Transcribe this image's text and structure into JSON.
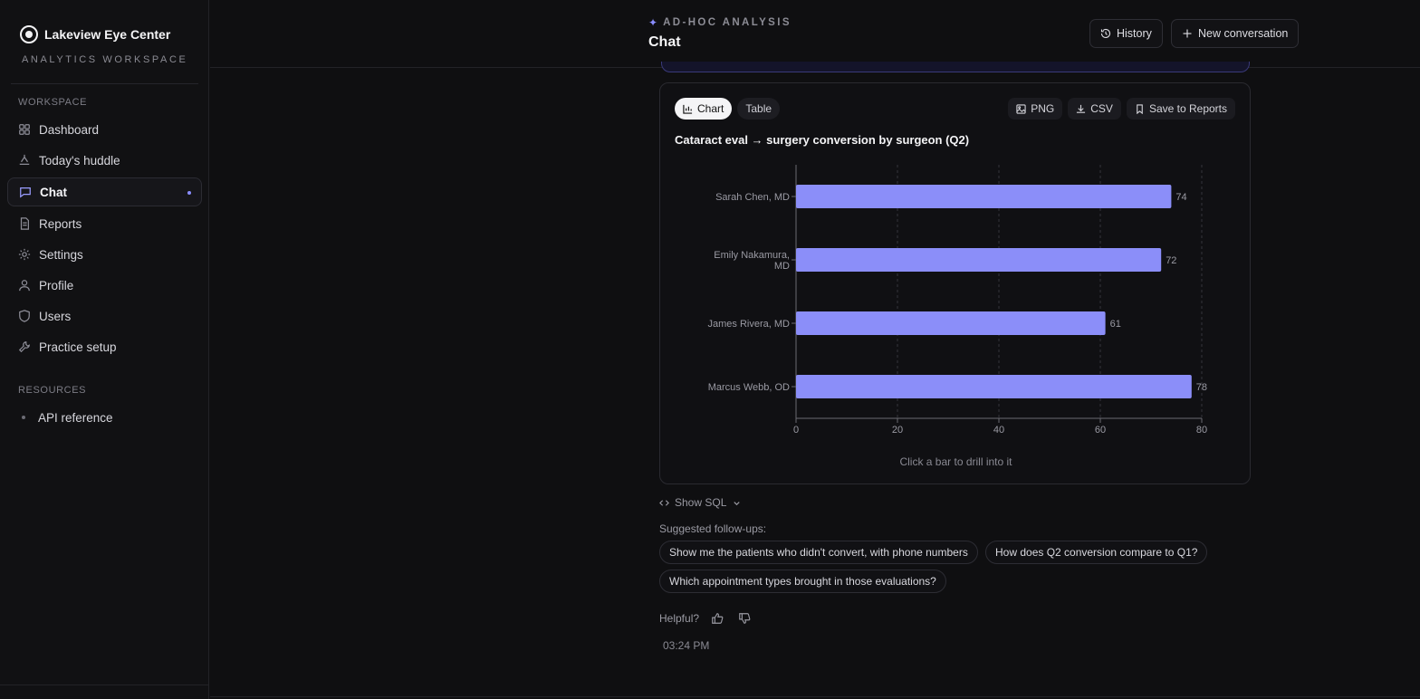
{
  "brand": {
    "name": "Lakeview Eye Center",
    "subtitle": "ANALYTICS WORKSPACE"
  },
  "sidebar": {
    "workspace_label": "WORKSPACE",
    "items": [
      {
        "label": "Dashboard",
        "icon": "grid-icon"
      },
      {
        "label": "Today's huddle",
        "icon": "huddle-icon"
      },
      {
        "label": "Chat",
        "icon": "chat-icon",
        "active": true
      },
      {
        "label": "Reports",
        "icon": "document-icon"
      },
      {
        "label": "Settings",
        "icon": "gear-icon"
      },
      {
        "label": "Profile",
        "icon": "user-icon"
      },
      {
        "label": "Users",
        "icon": "shield-icon"
      },
      {
        "label": "Practice setup",
        "icon": "wrench-icon"
      }
    ],
    "resources_label": "RESOURCES",
    "resources": [
      {
        "label": "API reference"
      }
    ]
  },
  "header": {
    "kicker": "AD-HOC ANALYSIS",
    "title": "Chat",
    "history_label": "History",
    "new_conversation_label": "New conversation"
  },
  "chart_card": {
    "tab_chart": "Chart",
    "tab_table": "Table",
    "png_label": "PNG",
    "csv_label": "CSV",
    "save_label": "Save to Reports",
    "hint": "Click a bar to drill into it"
  },
  "chart_data": {
    "type": "bar",
    "orientation": "horizontal",
    "title": "Cataract eval → surgery conversion by surgeon (Q2)",
    "categories": [
      "Sarah Chen, MD",
      "Emily Nakamura, MD",
      "James Rivera, MD",
      "Marcus Webb, OD"
    ],
    "values": [
      74,
      72,
      61,
      78
    ],
    "xlim": [
      0,
      80
    ],
    "xticks": [
      0,
      20,
      40,
      60,
      80
    ],
    "grid": true,
    "bar_color": "#8b8ef9"
  },
  "show_sql_label": "Show SQL",
  "suggestions": {
    "label": "Suggested follow-ups:",
    "items": [
      "Show me the patients who didn't convert, with phone numbers",
      "How does Q2 conversion compare to Q1?",
      "Which appointment types brought in those evaluations?"
    ]
  },
  "feedback": {
    "label": "Helpful?"
  },
  "timestamp": "03:24 PM"
}
